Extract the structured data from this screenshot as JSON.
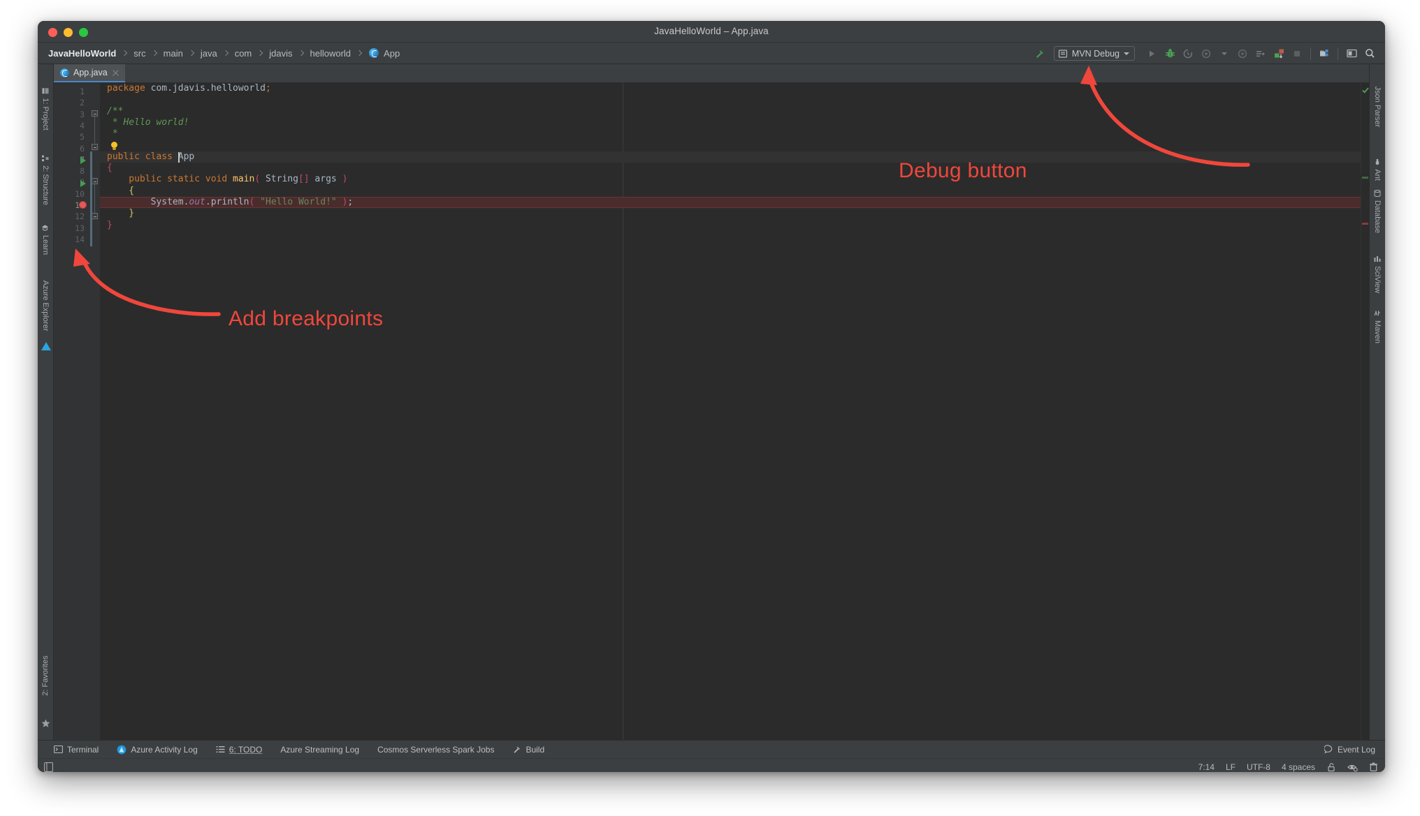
{
  "window": {
    "title": "JavaHelloWorld – App.java",
    "traffic_lights": [
      "close",
      "minimize",
      "zoom"
    ]
  },
  "navbar": {
    "breadcrumbs": [
      {
        "label": "JavaHelloWorld",
        "root": true
      },
      {
        "label": "src"
      },
      {
        "label": "main"
      },
      {
        "label": "java"
      },
      {
        "label": "com"
      },
      {
        "label": "jdavis"
      },
      {
        "label": "helloworld"
      },
      {
        "label": "App",
        "icon": "java-class-icon"
      }
    ]
  },
  "toolbar": {
    "build_icon": "hammer-icon",
    "run_config": "MVN Debug",
    "dropdown_icon": "chevron-down-icon",
    "buttons": [
      {
        "name": "run-button",
        "icon": "play-icon",
        "enabled": false
      },
      {
        "name": "debug-button",
        "icon": "bug-icon",
        "enabled": true
      },
      {
        "name": "run-coverage-button",
        "icon": "coverage-icon",
        "enabled": false
      },
      {
        "name": "profile-button",
        "icon": "profile-icon",
        "enabled": false
      },
      {
        "name": "profile-dropdown",
        "icon": "chevron-down-icon",
        "enabled": false
      },
      {
        "name": "attach-process-button",
        "icon": "attach-icon",
        "enabled": false
      },
      {
        "name": "run-anything-button",
        "icon": "run-anything-icon",
        "enabled": false
      },
      {
        "name": "update-application-button",
        "icon": "update-app-icon",
        "enabled": true
      },
      {
        "name": "stop-button",
        "icon": "stop-square-icon",
        "enabled": false
      },
      {
        "name": "project-structure-button",
        "icon": "project-structure-icon",
        "enabled": true
      },
      {
        "name": "preview-button",
        "icon": "preview-window-icon",
        "enabled": true
      },
      {
        "name": "search-everywhere-button",
        "icon": "search-icon",
        "enabled": true
      }
    ]
  },
  "left_strip": {
    "top_items": [
      {
        "label": "1: Project",
        "icon": "project-icon"
      },
      {
        "label": "2: Structure",
        "icon": "structure-icon"
      },
      {
        "label": "Learn",
        "icon": "learn-icon"
      },
      {
        "label": "Azure Explorer",
        "icon": "azure-icon"
      }
    ],
    "bottom_items": [
      {
        "label": "2: Favorites",
        "icon": "star-icon"
      }
    ]
  },
  "right_strip": {
    "items": [
      {
        "label": "Json Parser",
        "icon": "json-icon"
      },
      {
        "label": "Ant",
        "icon": "ant-icon"
      },
      {
        "label": "Database",
        "icon": "database-icon"
      },
      {
        "label": "SciView",
        "icon": "sciview-icon"
      },
      {
        "label": "Maven",
        "icon": "maven-icon"
      }
    ]
  },
  "tabs": [
    {
      "label": "App.java",
      "icon": "java-class-icon",
      "active": true,
      "close_icon": "close-icon"
    }
  ],
  "editor": {
    "caret_position": "7:14",
    "breakpoint_lines": [
      11
    ],
    "caret_line": 7,
    "gutter_run_markers": [
      7,
      9
    ],
    "lines": [
      {
        "n": 1,
        "text": "package com.jdavis.helloworld;"
      },
      {
        "n": 2,
        "text": ""
      },
      {
        "n": 3,
        "text": "/**"
      },
      {
        "n": 4,
        "text": " * Hello world!"
      },
      {
        "n": 5,
        "text": " *"
      },
      {
        "n": 6,
        "text": " */"
      },
      {
        "n": 7,
        "text": "public class App"
      },
      {
        "n": 8,
        "text": "{"
      },
      {
        "n": 9,
        "text": "    public static void main( String[] args )"
      },
      {
        "n": 10,
        "text": "    {"
      },
      {
        "n": 11,
        "text": "        System.out.println( \"Hello World!\" );"
      },
      {
        "n": 12,
        "text": "    }"
      },
      {
        "n": 13,
        "text": "}"
      },
      {
        "n": 14,
        "text": ""
      }
    ]
  },
  "bottom_bar": {
    "items": [
      {
        "label": "Terminal",
        "icon": "terminal-icon"
      },
      {
        "label": "Azure Activity Log",
        "icon": "azure-icon"
      },
      {
        "label": "6: TODO",
        "icon": "todo-list-icon"
      },
      {
        "label": "Azure Streaming Log",
        "icon": ""
      },
      {
        "label": "Cosmos Serverless Spark Jobs",
        "icon": ""
      },
      {
        "label": "Build",
        "icon": "hammer-icon"
      }
    ],
    "event_log": {
      "label": "Event Log",
      "icon": "balloon-icon"
    }
  },
  "status_bar": {
    "left_icon": "toggle-toolbar-icon",
    "caret": "7:14",
    "line_separator": "LF",
    "encoding": "UTF-8",
    "indent": "4 spaces",
    "icons": [
      "lock-open-icon",
      "inspection-eye-icon",
      "trash-icon"
    ]
  },
  "annotations": [
    {
      "id": "debug",
      "text": "Debug button",
      "color": "#f0473c"
    },
    {
      "id": "breakpoints",
      "text": "Add breakpoints",
      "color": "#f0473c"
    }
  ],
  "colors": {
    "accent": "#4a88c7",
    "annotation": "#f0473c",
    "editor_bg": "#2b2b2b",
    "chrome_bg": "#3c3f41",
    "breakpoint": "#e05a5a",
    "debug_green": "#499c54"
  }
}
